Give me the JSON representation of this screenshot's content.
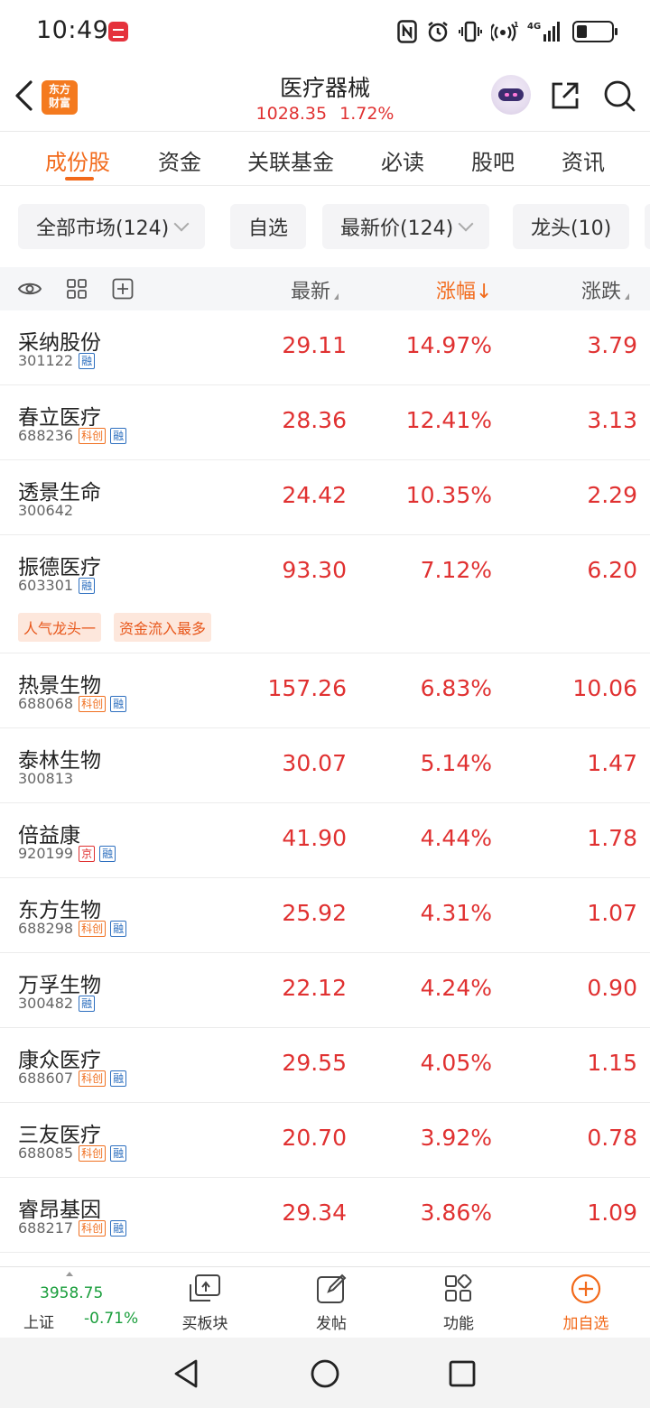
{
  "status_bar": {
    "time": "10:49",
    "network": "4G",
    "battery_level": 0.3
  },
  "header": {
    "logo_text": "东方财富",
    "title": "医疗器械",
    "index_value": "1028.35",
    "index_change": "1.72%"
  },
  "tabs": [
    {
      "label": "成份股",
      "active": true
    },
    {
      "label": "资金"
    },
    {
      "label": "关联基金"
    },
    {
      "label": "必读"
    },
    {
      "label": "股吧"
    },
    {
      "label": "资讯"
    }
  ],
  "filters": [
    {
      "label": "全部市场(124)",
      "dropdown": true
    },
    {
      "label": "自选",
      "dropdown": false
    },
    {
      "label": "最新价(124)",
      "dropdown": true
    },
    {
      "label": "龙头(10)",
      "dropdown": false
    }
  ],
  "table_header": {
    "price": "最新",
    "pct": "涨幅↓",
    "change": "涨跌"
  },
  "stocks": [
    {
      "name": "采纳股份",
      "code": "301122",
      "tags": [
        "融"
      ],
      "price": "29.11",
      "pct": "14.97%",
      "change": "3.79"
    },
    {
      "name": "春立医疗",
      "code": "688236",
      "tags": [
        "科创",
        "融"
      ],
      "price": "28.36",
      "pct": "12.41%",
      "change": "3.13"
    },
    {
      "name": "透景生命",
      "code": "300642",
      "tags": [],
      "price": "24.42",
      "pct": "10.35%",
      "change": "2.29"
    },
    {
      "name": "振德医疗",
      "code": "603301",
      "tags": [
        "融"
      ],
      "price": "93.30",
      "pct": "7.12%",
      "change": "6.20",
      "hot_tags": [
        "人气龙头一",
        "资金流入最多"
      ]
    },
    {
      "name": "热景生物",
      "code": "688068",
      "tags": [
        "科创",
        "融"
      ],
      "price": "157.26",
      "pct": "6.83%",
      "change": "10.06"
    },
    {
      "name": "泰林生物",
      "code": "300813",
      "tags": [],
      "price": "30.07",
      "pct": "5.14%",
      "change": "1.47"
    },
    {
      "name": "倍益康",
      "code": "920199",
      "tags": [
        "京",
        "融"
      ],
      "price": "41.90",
      "pct": "4.44%",
      "change": "1.78"
    },
    {
      "name": "东方生物",
      "code": "688298",
      "tags": [
        "科创",
        "融"
      ],
      "price": "25.92",
      "pct": "4.31%",
      "change": "1.07"
    },
    {
      "name": "万孚生物",
      "code": "300482",
      "tags": [
        "融"
      ],
      "price": "22.12",
      "pct": "4.24%",
      "change": "0.90"
    },
    {
      "name": "康众医疗",
      "code": "688607",
      "tags": [
        "科创",
        "融"
      ],
      "price": "29.55",
      "pct": "4.05%",
      "change": "1.15"
    },
    {
      "name": "三友医疗",
      "code": "688085",
      "tags": [
        "科创",
        "融"
      ],
      "price": "20.70",
      "pct": "3.92%",
      "change": "0.78"
    },
    {
      "name": "睿昂基因",
      "code": "688217",
      "tags": [
        "科创",
        "融"
      ],
      "price": "29.34",
      "pct": "3.86%",
      "change": "1.09"
    }
  ],
  "bottom_bar": {
    "index_value": "3958.75",
    "index_name": "上证",
    "index_change": "-0.71%",
    "items": [
      {
        "label": "买板块",
        "icon": "buy-sector-icon"
      },
      {
        "label": "发帖",
        "icon": "post-edit-icon"
      },
      {
        "label": "功能",
        "icon": "apps-grid-icon"
      },
      {
        "label": "加自选",
        "icon": "add-circle-icon"
      }
    ]
  },
  "colors": {
    "accent": "#f26a1b",
    "up": "#e03131",
    "down": "#1a9e3c"
  }
}
